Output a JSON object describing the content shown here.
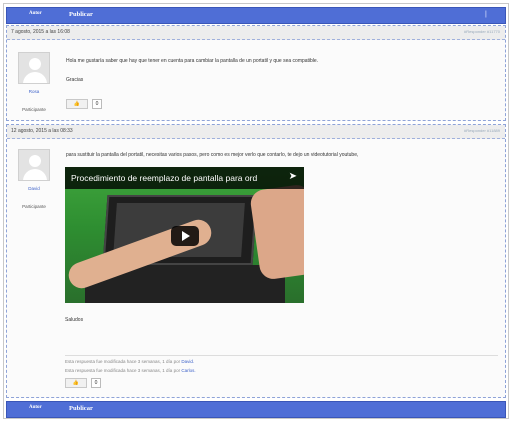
{
  "bar": {
    "author": "Autor",
    "publish": "Publicar",
    "pipe": "|"
  },
  "posts": [
    {
      "date": "7 agosto, 2015 a las 16:08",
      "id": "#Responder    #11770",
      "user": "Rosa",
      "role": "Participante",
      "text": "Hola me gustaría saber que hay que tener en cuenta para cambiar la pantalla de un portatil y que sea compatible.",
      "text2": "Gracias",
      "likes": "0"
    },
    {
      "date": "12 agosto, 2015 a las 08:33",
      "id": "#Responder    #11889",
      "user": "David",
      "role": "Participante",
      "text": "para sustituir la pantalla del portatil, necesitas varios pasos, pero como es mejor verlo que contarlo, te dejo un videotutorial youtube,",
      "video_title": "Procedimiento de reemplazo de pantalla para ord",
      "text2": "Saludos",
      "mod1_prefix": "Esta respuesta fue modificada hace 3 semanas, 1 día por",
      "mod1_user": "David.",
      "mod2_prefix": "Esta respuesta fue modificada hace 3 semanas, 1 día por",
      "mod2_user": "Carlos.",
      "likes": "0"
    }
  ],
  "icons": {
    "like": "thumbs-up-icon",
    "play": "play-icon",
    "share": "share-icon"
  }
}
